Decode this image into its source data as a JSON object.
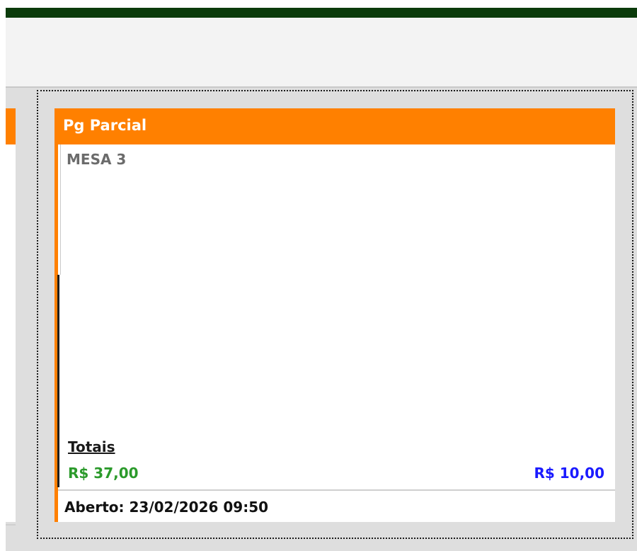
{
  "card": {
    "status": "Pg Parcial",
    "table_name": "MESA 3",
    "totals_label": "Totais",
    "total_consumed": "R$ 37,00",
    "total_paid": "R$ 10,00",
    "opened_at": "Aberto: 23/02/2026 09:50"
  },
  "colors": {
    "top_bar": "#0b3b0b",
    "card_header": "#ff8000",
    "total_consumed": "#2b9a2b",
    "total_paid": "#1a1aff"
  }
}
